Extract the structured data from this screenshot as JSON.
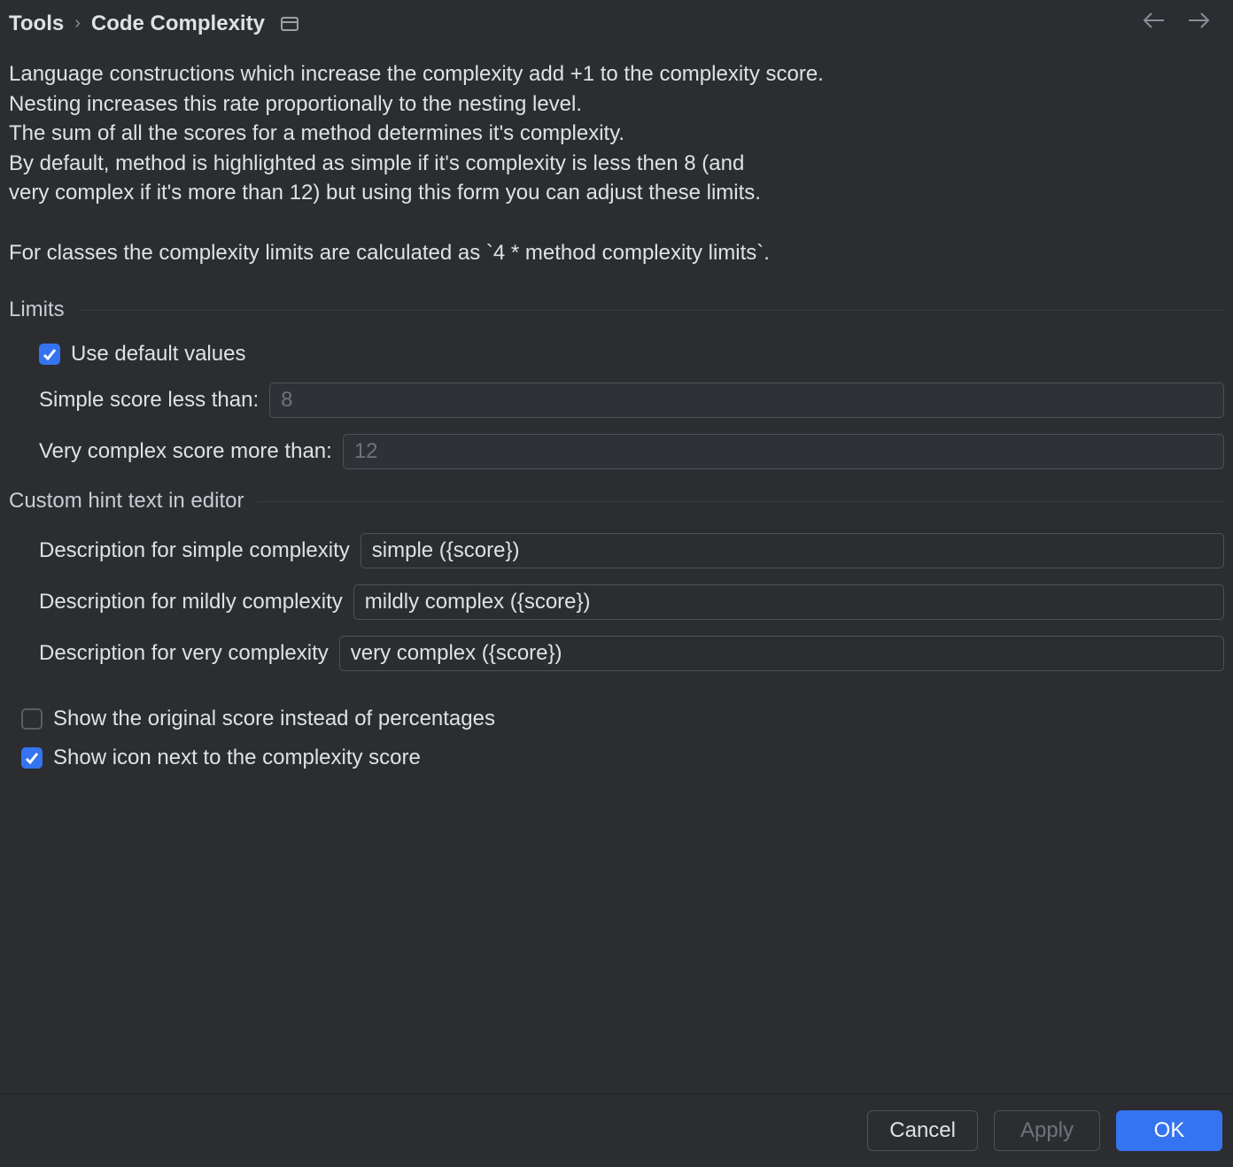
{
  "breadcrumb": {
    "parent": "Tools",
    "current": "Code Complexity"
  },
  "description": "Language constructions which increase the complexity add +1 to the complexity score.\nNesting increases this rate proportionally to the nesting level.\nThe sum of all the scores for a method determines it's complexity.\nBy default, method is highlighted as simple if it's complexity is less then 8 (and\nvery complex if it's more than 12) but using this form you can adjust these limits.\n\nFor classes the complexity limits are calculated as `4 * method complexity limits`.",
  "limits": {
    "section_label": "Limits",
    "use_defaults_label": "Use default values",
    "use_defaults_checked": true,
    "simple_label": "Simple score less than:",
    "simple_value": "8",
    "very_complex_label": "Very complex score more than:",
    "very_complex_value": "12"
  },
  "custom_hint": {
    "section_label": "Custom hint text in editor",
    "simple_label": "Description for simple complexity",
    "simple_value": "simple ({score})",
    "mildly_label": "Description for mildly complexity",
    "mildly_value": "mildly complex ({score})",
    "very_label": "Description for very complexity",
    "very_value": "very complex ({score})"
  },
  "options": {
    "show_original_label": "Show the original score instead of percentages",
    "show_original_checked": false,
    "show_icon_label": "Show icon next to the complexity score",
    "show_icon_checked": true
  },
  "footer": {
    "cancel": "Cancel",
    "apply": "Apply",
    "ok": "OK"
  }
}
